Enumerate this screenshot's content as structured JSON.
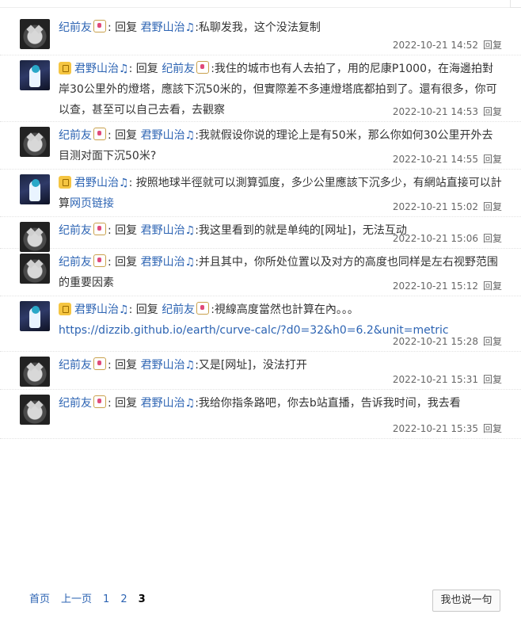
{
  "comments": [
    {
      "author": "纪前友",
      "avatar": "cat",
      "vip": false,
      "reply_word": "回复",
      "reply_to": "君野山治♫",
      "segments": [
        {
          "text": ":私聊发我，这个没法复制"
        }
      ],
      "time": "2022-10-21 14:52",
      "reply_label": "回复"
    },
    {
      "author": "君野山治♫",
      "avatar": "char",
      "vip": true,
      "reply_word": "回复",
      "reply_to": "纪前友",
      "segments": [
        {
          "text": ":我住的城市也有人去拍了，用的尼康P1000，在海邊拍對岸30公里外的燈塔，應該下沉50米的，但實際差不多連燈塔底都拍到了。還有很多，你可以查，甚至可以自己去看，去觀察"
        }
      ],
      "time": "2022-10-21 14:53",
      "reply_label": "回复"
    },
    {
      "author": "纪前友",
      "avatar": "cat",
      "vip": false,
      "reply_word": "回复",
      "reply_to": "君野山治♫",
      "segments": [
        {
          "text": ":我就假设你说的理论上是有50米，那么你如何30公里开外去目测对面下沉50米?"
        }
      ],
      "time": "2022-10-21 14:55",
      "reply_label": "回复"
    },
    {
      "author": "君野山治♫",
      "avatar": "char",
      "vip": true,
      "reply_word": "",
      "reply_to": "",
      "segments": [
        {
          "text": ": 按照地球半徑就可以測算弧度，多少公里應該下沉多少，有網站直接可以計算"
        },
        {
          "text": "网页链接",
          "link": true
        }
      ],
      "time": "2022-10-21 15:02",
      "reply_label": "回复"
    },
    {
      "author": "纪前友",
      "avatar": "cat",
      "vip": false,
      "reply_word": "回复",
      "reply_to": "君野山治♫",
      "segments": [
        {
          "text": ":我这里看到的就是单纯的[网址]，无法互动"
        }
      ],
      "time": "2022-10-21 15:06",
      "reply_label": "回复"
    },
    {
      "author": "纪前友",
      "avatar": "cat",
      "vip": false,
      "reply_word": "回复",
      "reply_to": "君野山治♫",
      "segments": [
        {
          "text": ":并且其中，你所处位置以及对方的高度也同样是左右视野范围的重要因素"
        }
      ],
      "time": "2022-10-21 15:12",
      "reply_label": "回复"
    },
    {
      "author": "君野山治♫",
      "avatar": "char",
      "vip": true,
      "reply_word": "回复",
      "reply_to": "纪前友",
      "segments": [
        {
          "text": ":視線高度當然也計算在內。。。"
        },
        {
          "text": "https://dizzib.github.io/earth/curve-calc/?d0=32&h0=6.2&unit=metric",
          "link": true,
          "newline": true
        }
      ],
      "time": "2022-10-21 15:28",
      "reply_label": "回复"
    },
    {
      "author": "纪前友",
      "avatar": "cat",
      "vip": false,
      "reply_word": "回复",
      "reply_to": "君野山治♫",
      "segments": [
        {
          "text": ":又是[网址]，没法打开"
        }
      ],
      "time": "2022-10-21 15:31",
      "reply_label": "回复"
    },
    {
      "author": "纪前友",
      "avatar": "cat",
      "vip": false,
      "reply_word": "回复",
      "reply_to": "君野山治♫",
      "segments": [
        {
          "text": ":我给你指条路吧，你去b站直播，告诉我时间，我去看"
        }
      ],
      "time": "2022-10-21 15:35",
      "reply_label": "回复"
    }
  ],
  "pager": {
    "first": "首页",
    "prev": "上一页",
    "pages": [
      "1",
      "2",
      "3"
    ],
    "current": "3"
  },
  "reply_all_button": "我也说一句",
  "colors": {
    "link": "#2d64b3",
    "text": "#333333",
    "meta": "#666666"
  }
}
